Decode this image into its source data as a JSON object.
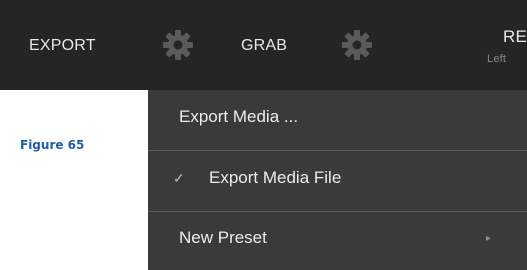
{
  "toolbar": {
    "export_label": "EXPORT",
    "grab_label": "GRAB",
    "record_label_partial": "RE",
    "record_sublabel_partial": "Left"
  },
  "figure_caption": "Figure 65",
  "menu": {
    "items": [
      {
        "label": "Export Media ..."
      },
      {
        "label": "Export Media File",
        "checked": true,
        "check_glyph": "✓"
      },
      {
        "label": "New Preset",
        "has_submenu": true,
        "submenu_glyph": "▸"
      }
    ]
  },
  "icons": {
    "gear": "gear-icon",
    "check": "check-icon",
    "submenu": "chevron-right-icon"
  },
  "colors": {
    "toolbar_bg": "#252525",
    "menu_bg": "#3a3a3a",
    "menu_text": "#ececec",
    "gear": "#5a5a5a",
    "caption": "#1f5ea8"
  }
}
